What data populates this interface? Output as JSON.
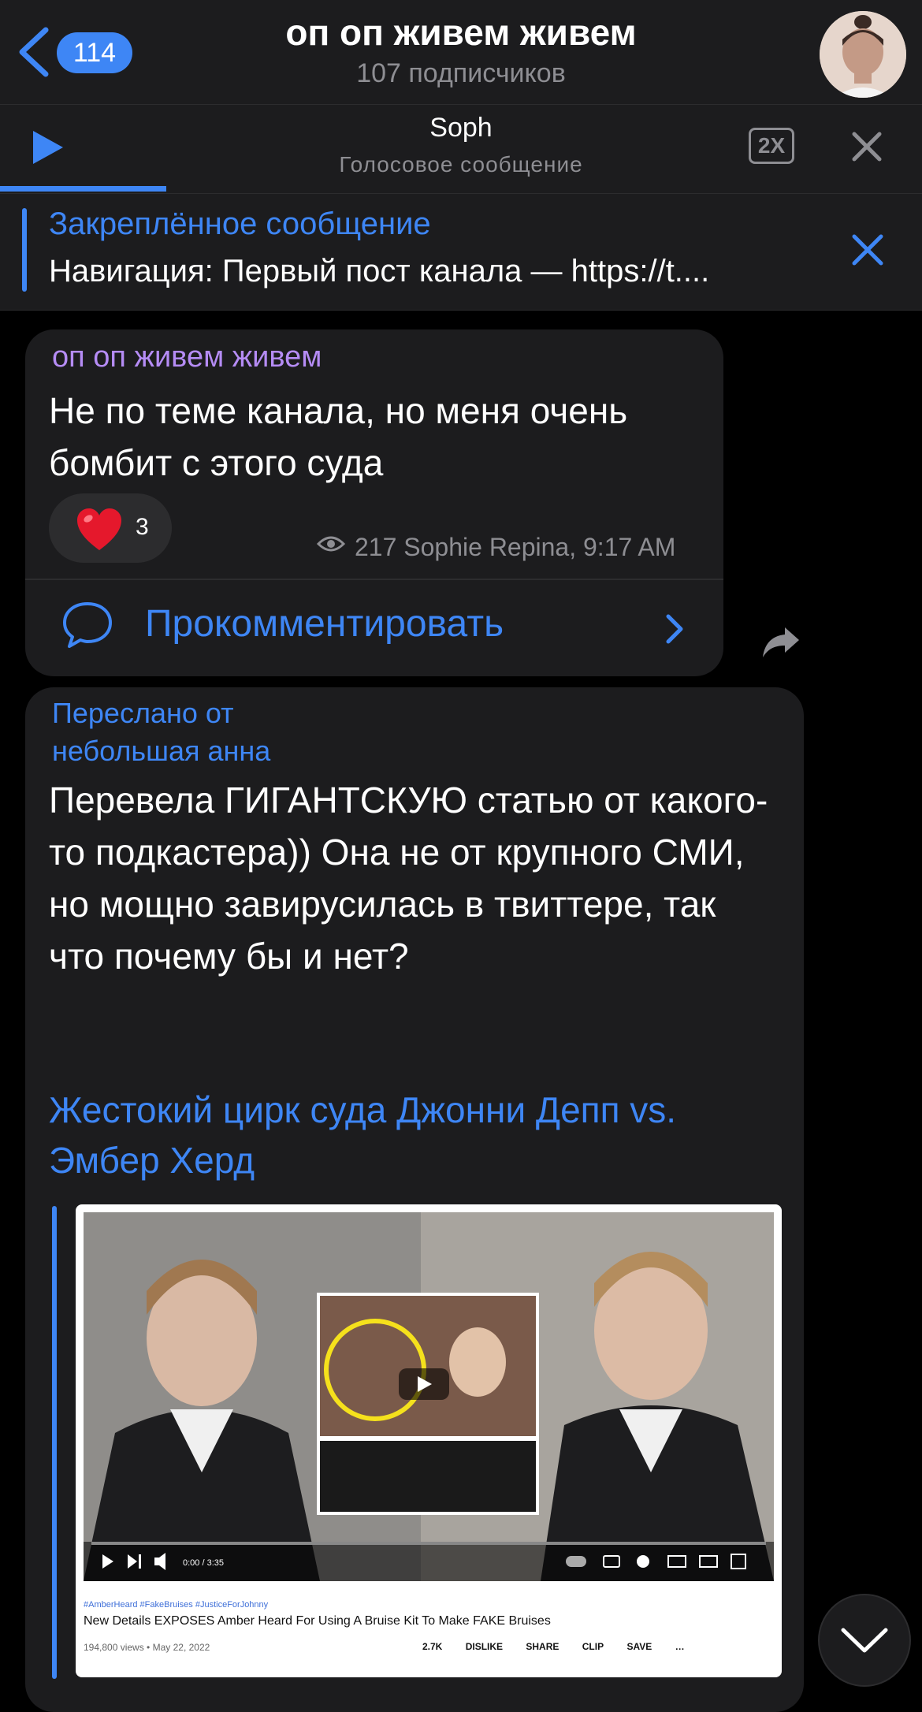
{
  "header": {
    "back_count": "114",
    "title": "оп оп живем живем",
    "subtitle": "107 подписчиков"
  },
  "audio_player": {
    "name": "Soph",
    "subtitle": "Голосовое сообщение",
    "speed": "2X",
    "progress": 0.18
  },
  "pinned": {
    "title": "Закреплённое сообщение",
    "text": "Навигация:  Первый пост канала — https://t...."
  },
  "message1": {
    "sender": "оп оп живем живем",
    "text": "Не по теме канала, но меня очень бомбит с этого суда",
    "reaction_count": "3",
    "meta": "217 Sophie Repina, 9:17 AM",
    "comment_label": "Прокомментировать"
  },
  "message2": {
    "forwarded_label": "Переслано от",
    "forwarded_from": "небольшая анна",
    "text": "Перевела ГИГАНТСКУЮ статью от какого-то подкастера)) Она не от крупного СМИ, но мощно завирусилась в твиттере, так что почему бы и нет?",
    "link_title": "Жестокий цирк суда Джонни Депп vs. Эмбер Херд"
  },
  "video_preview": {
    "time": "0:00 / 3:35",
    "tags": "#AmberHeard #FakeBruises #JusticeForJohnny",
    "title": "New Details EXPOSES Amber Heard For Using A Bruise Kit To Make FAKE Bruises",
    "views": "194,800 views • May 22, 2022",
    "likes": "2.7K",
    "dislike": "DISLIKE",
    "share": "SHARE",
    "clip": "CLIP",
    "save": "SAVE"
  },
  "colors": {
    "accent": "#3e86f5",
    "sender": "#b58cf5",
    "bubble": "#1c1c1e",
    "background": "#000000"
  }
}
